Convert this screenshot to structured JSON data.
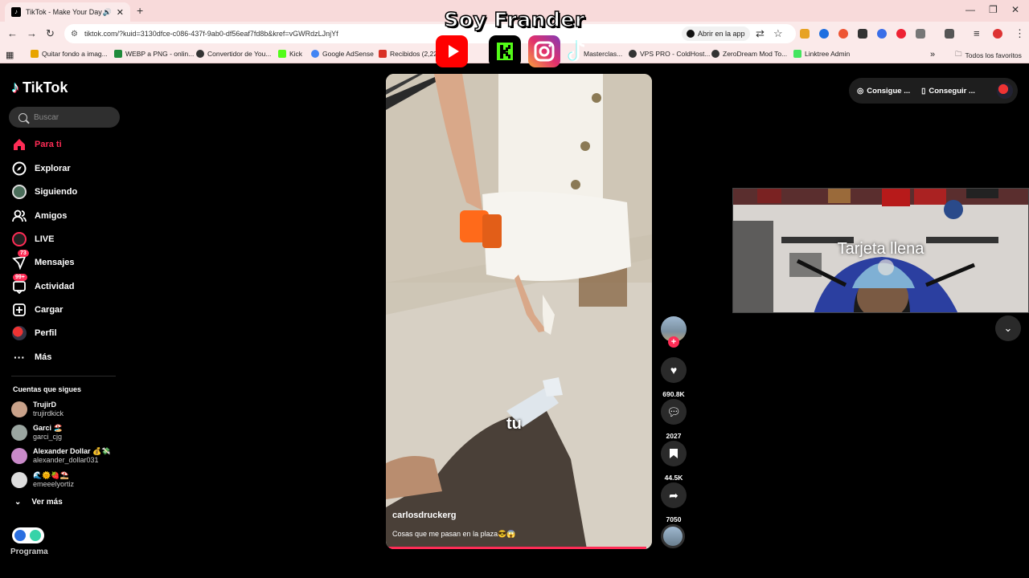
{
  "browser": {
    "tab_title": "TikTok - Make Your Day",
    "url": "tiktok.com/?kuid=3130dfce-c086-437f-9ab0-df56eaf7fd8b&kref=vGWRdzLJnjYf",
    "open_in_app": "Abrir en la app",
    "bookmarks": [
      {
        "label": "Quitar fondo a imag...",
        "color": "#e8a400"
      },
      {
        "label": "WEBP a PNG - onlin...",
        "color": "#1f8a3a"
      },
      {
        "label": "Convertidor de You...",
        "color": "#333333"
      },
      {
        "label": "Kick",
        "color": "#53fc18"
      },
      {
        "label": "Google AdSense",
        "color": "#4285f4"
      },
      {
        "label": "Recibidos (2,229)",
        "color": "#d93025"
      },
      {
        "label": "Masterclas...",
        "color": "#555555"
      },
      {
        "label": "VPS PRO - ColdHost...",
        "color": "#333333"
      },
      {
        "label": "ZeroDream Mod To...",
        "color": "#333333"
      },
      {
        "label": "Linktree Admin",
        "color": "#43e55e"
      }
    ],
    "all_bookmarks": "Todos los favoritos"
  },
  "overlay": {
    "brand_title": "Soy Frander",
    "socials": [
      {
        "icon": "youtube-icon",
        "color": "#ff0000"
      },
      {
        "icon": "kick-icon",
        "color": "#000000"
      },
      {
        "icon": "instagram-icon",
        "color": "#c13584"
      },
      {
        "icon": "tiktok-icon",
        "color": "#ffffff"
      }
    ]
  },
  "tiktok": {
    "logo": "TikTok",
    "search_placeholder": "Buscar",
    "nav": [
      {
        "label": "Para ti",
        "icon": "home-icon",
        "active": true
      },
      {
        "label": "Explorar",
        "icon": "compass-icon"
      },
      {
        "label": "Siguiendo",
        "icon": "following-avatar-icon"
      },
      {
        "label": "Amigos",
        "icon": "friends-icon"
      },
      {
        "label": "LIVE",
        "icon": "live-icon"
      },
      {
        "label": "Mensajes",
        "icon": "messages-icon",
        "badge": "73"
      },
      {
        "label": "Actividad",
        "icon": "activity-icon",
        "badge": "99+"
      },
      {
        "label": "Cargar",
        "icon": "upload-icon"
      },
      {
        "label": "Perfil",
        "icon": "profile-icon"
      },
      {
        "label": "Más",
        "icon": "more-icon"
      }
    ],
    "following_header": "Cuentas que sigues",
    "following": [
      {
        "name": "TrujirD",
        "handle": "trujirdkick",
        "color": "#c9a28a"
      },
      {
        "name": "Garci 🏖️",
        "handle": "garci_cjg",
        "color": "#9aa5a0"
      },
      {
        "name": "Alexander Dollar 💰💸",
        "handle": "alexander_dollar031",
        "color": "#c98ac9"
      },
      {
        "name": "🌊🌞🍓⛱️",
        "handle": "emeeelyortiz",
        "color": "#dddddd"
      }
    ],
    "see_more": "Ver más",
    "program_label": "Programa",
    "video": {
      "author": "carlosdruckerg",
      "caption": "Cosas que me pasan en la plaza😎😱",
      "subtitle": "tu",
      "progress": 0.98
    },
    "actions": {
      "likes": "690.8K",
      "comments": "2027",
      "saves": "44.5K",
      "shares": "7050"
    },
    "top_right": {
      "get_coins": "Consigue ...",
      "get_app": "Conseguir ..."
    }
  },
  "webcam": {
    "label": "Tarjeta llena"
  }
}
